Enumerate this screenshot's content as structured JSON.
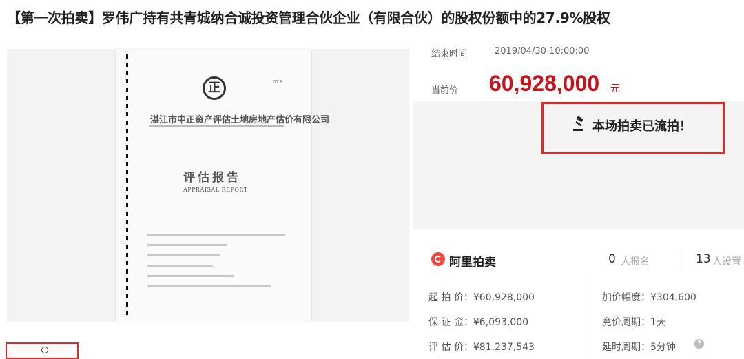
{
  "title": "【第一次拍卖】罗伟广持有共青城纳合诚投资管理合伙企业（有限合伙）的股权份额中的27.9%股权",
  "document": {
    "seal_char": "正",
    "seal_number": "013",
    "company": "湛江市中正资产评估土地房地产估价有限公司",
    "report_title": "评估报告",
    "report_title_en": "APPRAISAL REPORT"
  },
  "auction": {
    "end_time_label": "结束时间",
    "end_time": "2019/04/30 10:00:00",
    "current_price_label": "当前价",
    "current_price": "60,928,000",
    "currency": "元",
    "status": "本场拍卖已流拍！"
  },
  "platform": {
    "name": "阿里拍卖",
    "signup_count": "0",
    "signup_label": "人报名",
    "reminder_count": "13",
    "reminder_label": "人设置"
  },
  "details": {
    "starting_price": "起 拍 价：¥60,928,000",
    "deposit": "保 证 金：¥6,093,000",
    "appraisal_price": "评 估 价：¥81,237,543",
    "increment": "加价幅度：¥304,600",
    "bid_cycle": "竞价周期：1天",
    "extension_cycle": "延时周期：5分钟"
  },
  "colors": {
    "accent": "#c5151e",
    "highlight_border": "#e02b28",
    "logo": "#ef4a41"
  },
  "icons": [
    "gavel-icon",
    "aliauction-logo-icon",
    "help-icon"
  ]
}
